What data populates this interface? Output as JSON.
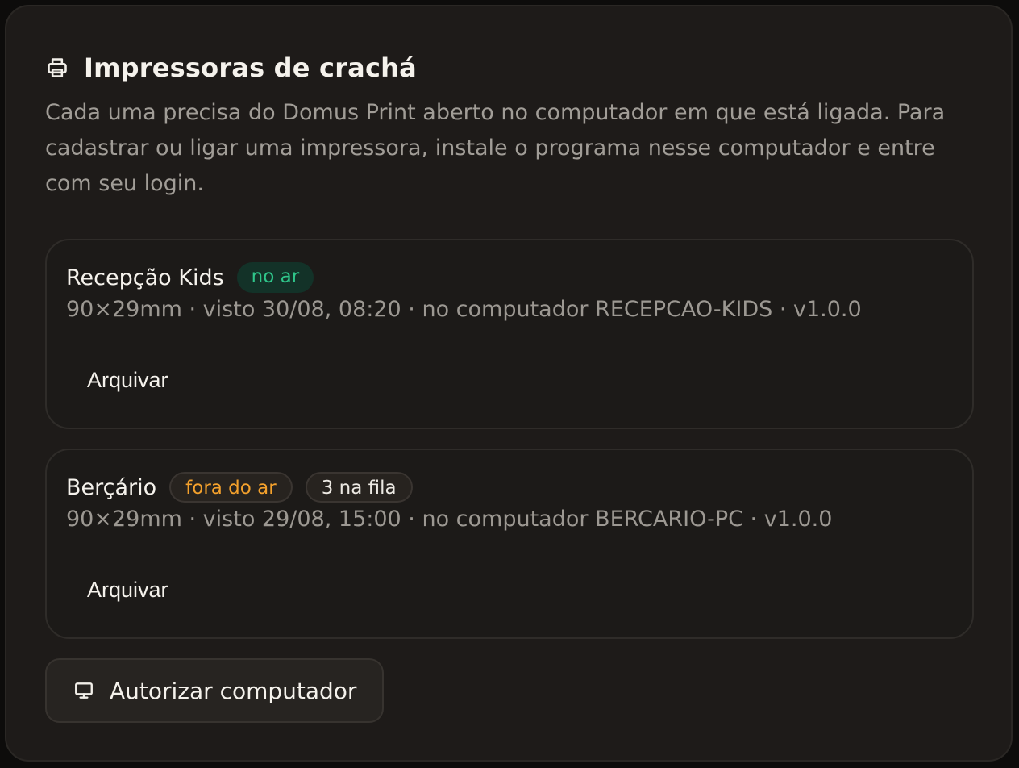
{
  "header": {
    "icon": "printer-icon",
    "title": "Impressoras de crachá",
    "description": "Cada uma precisa do Domus Print aberto no computador em que está ligada. Para cadastrar ou ligar uma impressora, instale o programa nesse computador e entre com seu login."
  },
  "printers": [
    {
      "name": "Recepção Kids",
      "status": "no ar",
      "status_color": "#2fc58a",
      "meta": "90×29mm · visto 30/08, 08:20 · no computador RECEPCAO-KIDS · v1.0.0",
      "archive_label": "Arquivar"
    },
    {
      "name": "Berçário",
      "status": "fora do ar",
      "status_color": "#f4a12c",
      "queue": "3 na fila",
      "meta": "90×29mm · visto 29/08, 15:00 · no computador BERCARIO-PC · v1.0.0",
      "archive_label": "Arquivar"
    }
  ],
  "authorize": {
    "icon": "monitor-icon",
    "label": "Autorizar computador"
  }
}
